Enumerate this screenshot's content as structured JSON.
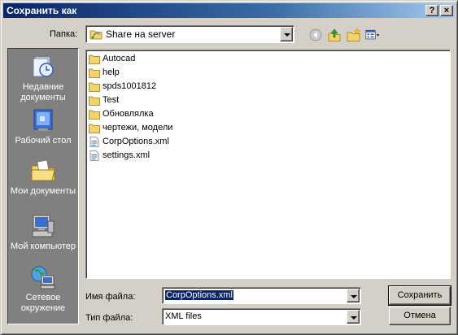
{
  "window": {
    "title": "Сохранить как",
    "help_glyph": "?",
    "close_glyph": "×"
  },
  "toolbar": {
    "lookin_label": "Папка:",
    "lookin_value": "Share на  server",
    "icons": [
      "back-icon",
      "up-folder-icon",
      "new-folder-icon",
      "views-menu-icon"
    ]
  },
  "places": [
    {
      "label": "Недавние документы",
      "icon": "recent-documents-icon"
    },
    {
      "label": "Рабочий стол",
      "icon": "desktop-icon"
    },
    {
      "label": "Мои документы",
      "icon": "my-documents-icon"
    },
    {
      "label": "Мой компьютер",
      "icon": "my-computer-icon"
    },
    {
      "label": "Сетевое окружение",
      "icon": "network-places-icon"
    }
  ],
  "files": [
    {
      "name": "Autocad",
      "type": "folder"
    },
    {
      "name": "help",
      "type": "folder"
    },
    {
      "name": "spds1001812",
      "type": "folder"
    },
    {
      "name": "Test",
      "type": "folder"
    },
    {
      "name": "Обновлялка",
      "type": "folder"
    },
    {
      "name": "чертежи, модели",
      "type": "folder"
    },
    {
      "name": "CorpOptions.xml",
      "type": "xml"
    },
    {
      "name": "settings.xml",
      "type": "xml"
    }
  ],
  "filename": {
    "label": "Имя файла:",
    "value": "CorpOptions.xml"
  },
  "filetype": {
    "label": "Тип файла:",
    "value": "XML files"
  },
  "buttons": {
    "save": "Сохранить",
    "cancel": "Отмена"
  },
  "colors": {
    "titlebar_start": "#0a246a",
    "titlebar_end": "#a6caf0",
    "face": "#d4d0c8",
    "places_bg": "#808080",
    "selection": "#0a246a"
  }
}
